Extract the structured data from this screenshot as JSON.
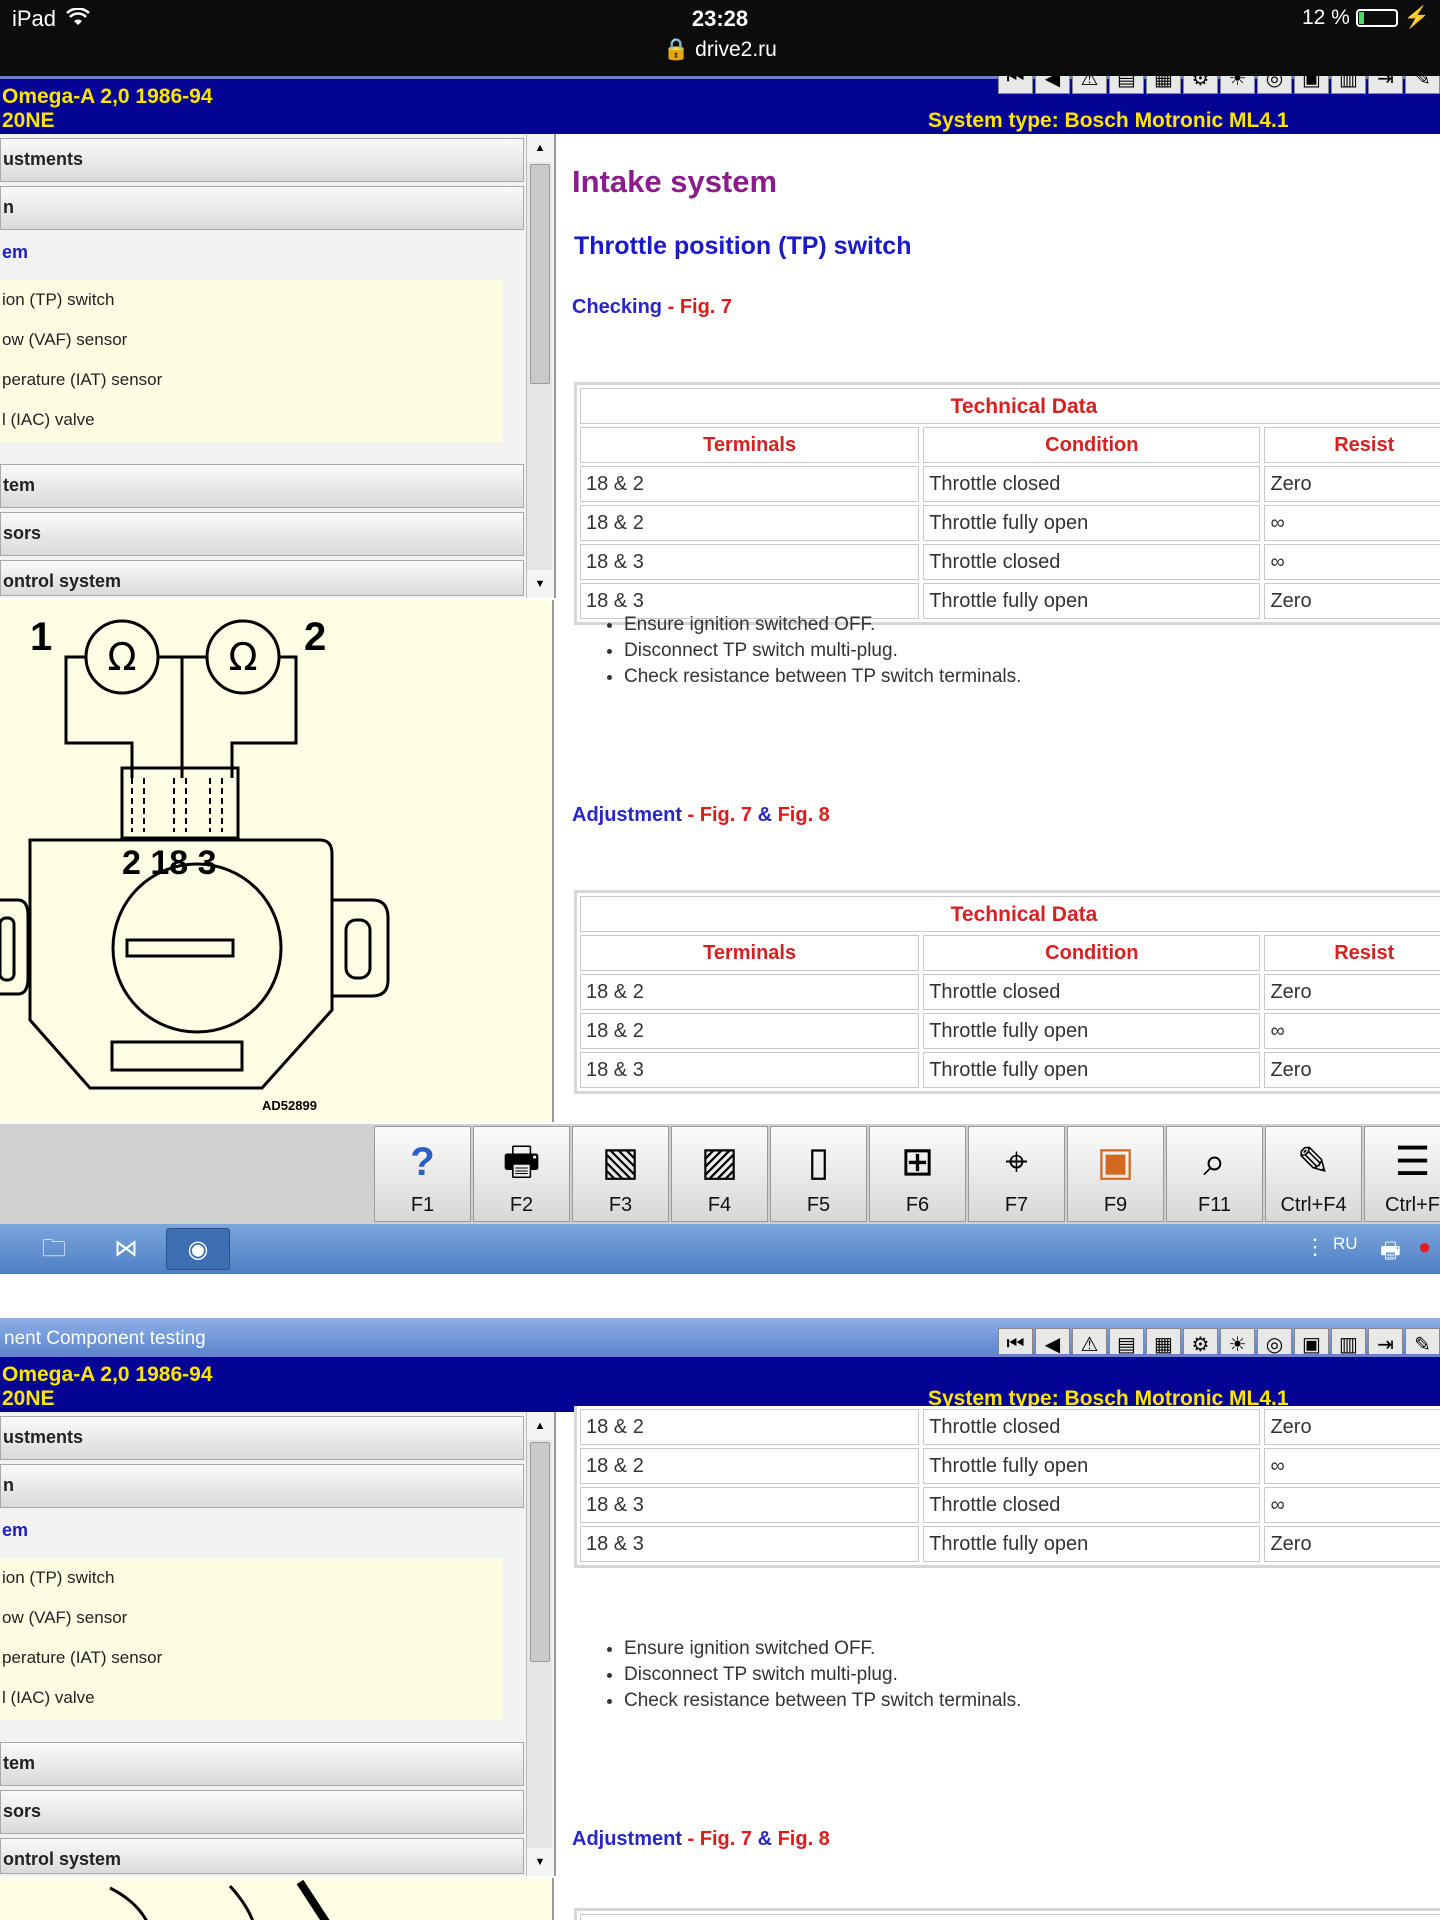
{
  "status_bar": {
    "device": "iPad",
    "time": "23:28",
    "url": "drive2.ru",
    "battery": "12 %",
    "battery_level": 0.12
  },
  "app": {
    "window_title": "nent Component testing",
    "vehicle_line1": "Omega-A  2,0  1986-94",
    "vehicle_line2": "20NE",
    "system_type": "System type: Bosch Motronic ML4.1"
  },
  "nav": {
    "rows": [
      "ustments",
      "n",
      "tem",
      "sors",
      "ontrol system"
    ],
    "selected": "em",
    "subitems": [
      "ion (TP) switch",
      "ow (VAF) sensor",
      "perature (IAT) sensor",
      "l (IAC) valve"
    ]
  },
  "content": {
    "section_title": "Intake system",
    "subtitle": "Throttle position (TP) switch",
    "checking_label": "Checking",
    "dash": " - ",
    "fig7": "Fig. 7",
    "amp": " & ",
    "fig8": "Fig. 8",
    "adjustment_label": "Adjustment",
    "table_title": "Technical Data",
    "headers": [
      "Terminals",
      "Condition",
      "Resist"
    ],
    "check_rows": [
      [
        "18 & 2",
        "Throttle closed",
        "Zero"
      ],
      [
        "18 & 2",
        "Throttle fully open",
        "∞"
      ],
      [
        "18 & 3",
        "Throttle closed",
        "∞"
      ],
      [
        "18 & 3",
        "Throttle fully open",
        "Zero"
      ]
    ],
    "adjust_rows": [
      [
        "18 & 2",
        "Throttle closed",
        "Zero"
      ],
      [
        "18 & 2",
        "Throttle fully open",
        "∞"
      ],
      [
        "18 & 3",
        "Throttle fully open",
        "Zero"
      ]
    ],
    "bullets": [
      "Ensure ignition switched OFF.",
      "Disconnect TP switch multi-plug.",
      "Check resistance between TP switch terminals."
    ]
  },
  "figure": {
    "meter_symbol": "Ω",
    "label_1": "1",
    "label_2": "2",
    "pins": "2 18 3",
    "ref": "AD52899"
  },
  "fkeys": [
    "F1",
    "F2",
    "F3",
    "F4",
    "F5",
    "F6",
    "F7",
    "F9",
    "F11",
    "Ctrl+F4",
    "Ctrl+F"
  ],
  "fkey_icons": [
    "help-icon",
    "printer-icon",
    "vehicle-data-icon",
    "diagram-icon",
    "component-icon",
    "connector-icon",
    "zoom-icon",
    "fuse-icon",
    "test-icon",
    "notes-icon",
    "list-icon"
  ],
  "taskbar": {
    "lang": "RU"
  }
}
